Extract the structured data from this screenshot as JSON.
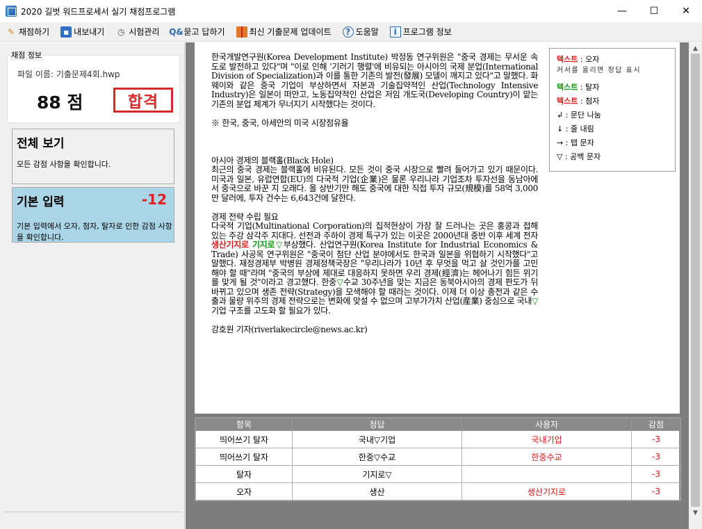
{
  "window": {
    "title": "2020 길벗 워드프로세서 실기 채점프로그램",
    "minimize": "—",
    "maximize": "☐",
    "close": "✕"
  },
  "menu": [
    {
      "label": "채점하기",
      "icon": "pencil-icon"
    },
    {
      "label": "내보내기",
      "icon": "save-icon"
    },
    {
      "label": "시험관리",
      "icon": "clock-icon"
    },
    {
      "label": "묻고 답하기",
      "icon": "qa-icon"
    },
    {
      "label": "최신 기출문제 업데이트",
      "icon": "gift-icon"
    },
    {
      "label": "도움말",
      "icon": "help-icon"
    },
    {
      "label": "프로그램 정보",
      "icon": "info-icon"
    }
  ],
  "left": {
    "group_label": "채점 정보",
    "file_name": "파일 이름: 기출문제4회.hwp",
    "score": "88 점",
    "stamp": "합격",
    "cards": [
      {
        "title": "전체 보기",
        "desc": "모든 감점 사항을 확인합니다."
      },
      {
        "title": "기본 입력",
        "deduct": "-12",
        "desc": "기본 입력에서 오자, 첨자, 탈자로 인한 감점 사항을 확인합니다."
      }
    ]
  },
  "doc": {
    "p1": "한국개발연구원(Korea Development Institute) 박정동 연구위원은 \"중국 경제는 무서운 속도로 발전하고 있다\"며 \"이로 인해 '기러기 행렬'에 비유되는 아시아의 국제 분업(International Division of Specialization)과 이를 통한 기존의 발전(發展) 모델이 깨지고 있다\"고 말했다. 화웨이와 같은 중국 기업이 부상하면서 자본과 기술집약적인 산업(Technology Intensive Industry)은 일본이 떠안고, 노동집약적인 산업은 저임 개도국(Developing Country)이 맡는 기존의 분업 체계가 무너지기 시작했다는 것이다.",
    "p2": "※ 한국, 중국, 아세안의 미국 시장점유율",
    "h3": "아시아 경제의 블랙홀(Black Hole)",
    "p3": "최근의 중국 경제는 블랙홀에 비유된다. 모든 것이 중국 시장으로 빨려 들어가고 있기 때문이다. 미국과 일본, 유럽연합(EU)의 다국적 기업(企業)은 물론 우리나라 기업조차 투자선을 동남아에서 중국으로 바꾼 지 오래다. 올 상반기만 해도 중국에 대한 직접 투자 규모(規模)를 58억 3,000만 달러에, 투자 건수는 6,643건에 달한다.",
    "h4": "경제 전략 수립 필요",
    "p4a": "다국적 기업(Multinational Corporation)의 집적현상이 가장 잘 드러나는 곳은 홍콩과 접해 있는 주강 삼각주 지대다. 선전과 주하이 경제 특구가 있는 이곳은 2000년대 중반 이후 세계 전자 ",
    "p4_red": "생산기지로",
    "p4_sp": " ",
    "p4_green": "기지로▽",
    "p4b": "부상했다. 산업연구원(Korea Institute for Industrial Economics & Trade) 사공목 연구위원은 \"중국이 첨단 산업 분야에서도 한국과 일본을 위협하기 시작했다\"고 말했다. 재정경제부 박병원 경제정책국장은 \"우리나라가 10년 후 무엇을 먹고 살 것인가를 고민해야 할 때\"라며 \"중국의 부상에 제대로 대응하지 못하면 우리 경제(經濟)는 헤어나기 힘든 위기를 맞게 될 것\"이라고 경고했다. 한중",
    "p4_green2": "▽",
    "p4c": "수교 30주년을 맞는 지금은 동북아시아의 경제 판도가 뒤바뀌고 있으며 생존 전략(Strategy)을 모색해야 할 때라는 것이다. 이제 더 이상 종전과 같은 수출과 물량 위주의 경제 전략으로는 변화에 맞설 수 없으며 고부가가치 산업(産業) 중심으로 국내",
    "p4_green3": "▽",
    "p4d": "기업 구조를 고도화 할 필요가 있다.",
    "sign": "강호원 기자(riverlakecircle@news.ac.kr)"
  },
  "legend": [
    {
      "mark": "텍스트",
      "sep": " : 오자",
      "color": "red"
    },
    {
      "note": "커서를 올리면 정답 표시"
    },
    {
      "mark": "텍스트",
      "sep": " : 탈자",
      "color": "green"
    },
    {
      "mark": "텍스트",
      "sep": " : 첨자",
      "color": "red"
    },
    {
      "text": "↲ : 문단 나눔"
    },
    {
      "text": "↓ : 줄 내림"
    },
    {
      "text": "→ : 탭 문자"
    },
    {
      "text": "▽ : 공백 문자"
    }
  ],
  "table": {
    "headers": [
      "항목",
      "정답",
      "사용자",
      "감점"
    ],
    "rows": [
      [
        "띄어쓰기 탈자",
        "국내▽기업",
        "국내기업",
        "-3"
      ],
      [
        "띄어쓰기 탈자",
        "한중▽수교",
        "한중수교",
        "-3"
      ],
      [
        "탈자",
        "기지로▽",
        "",
        "-3"
      ],
      [
        "오자",
        "생산",
        "생산기지로",
        "-3"
      ]
    ]
  },
  "scroll": {
    "up": "▲",
    "down": "▼"
  }
}
